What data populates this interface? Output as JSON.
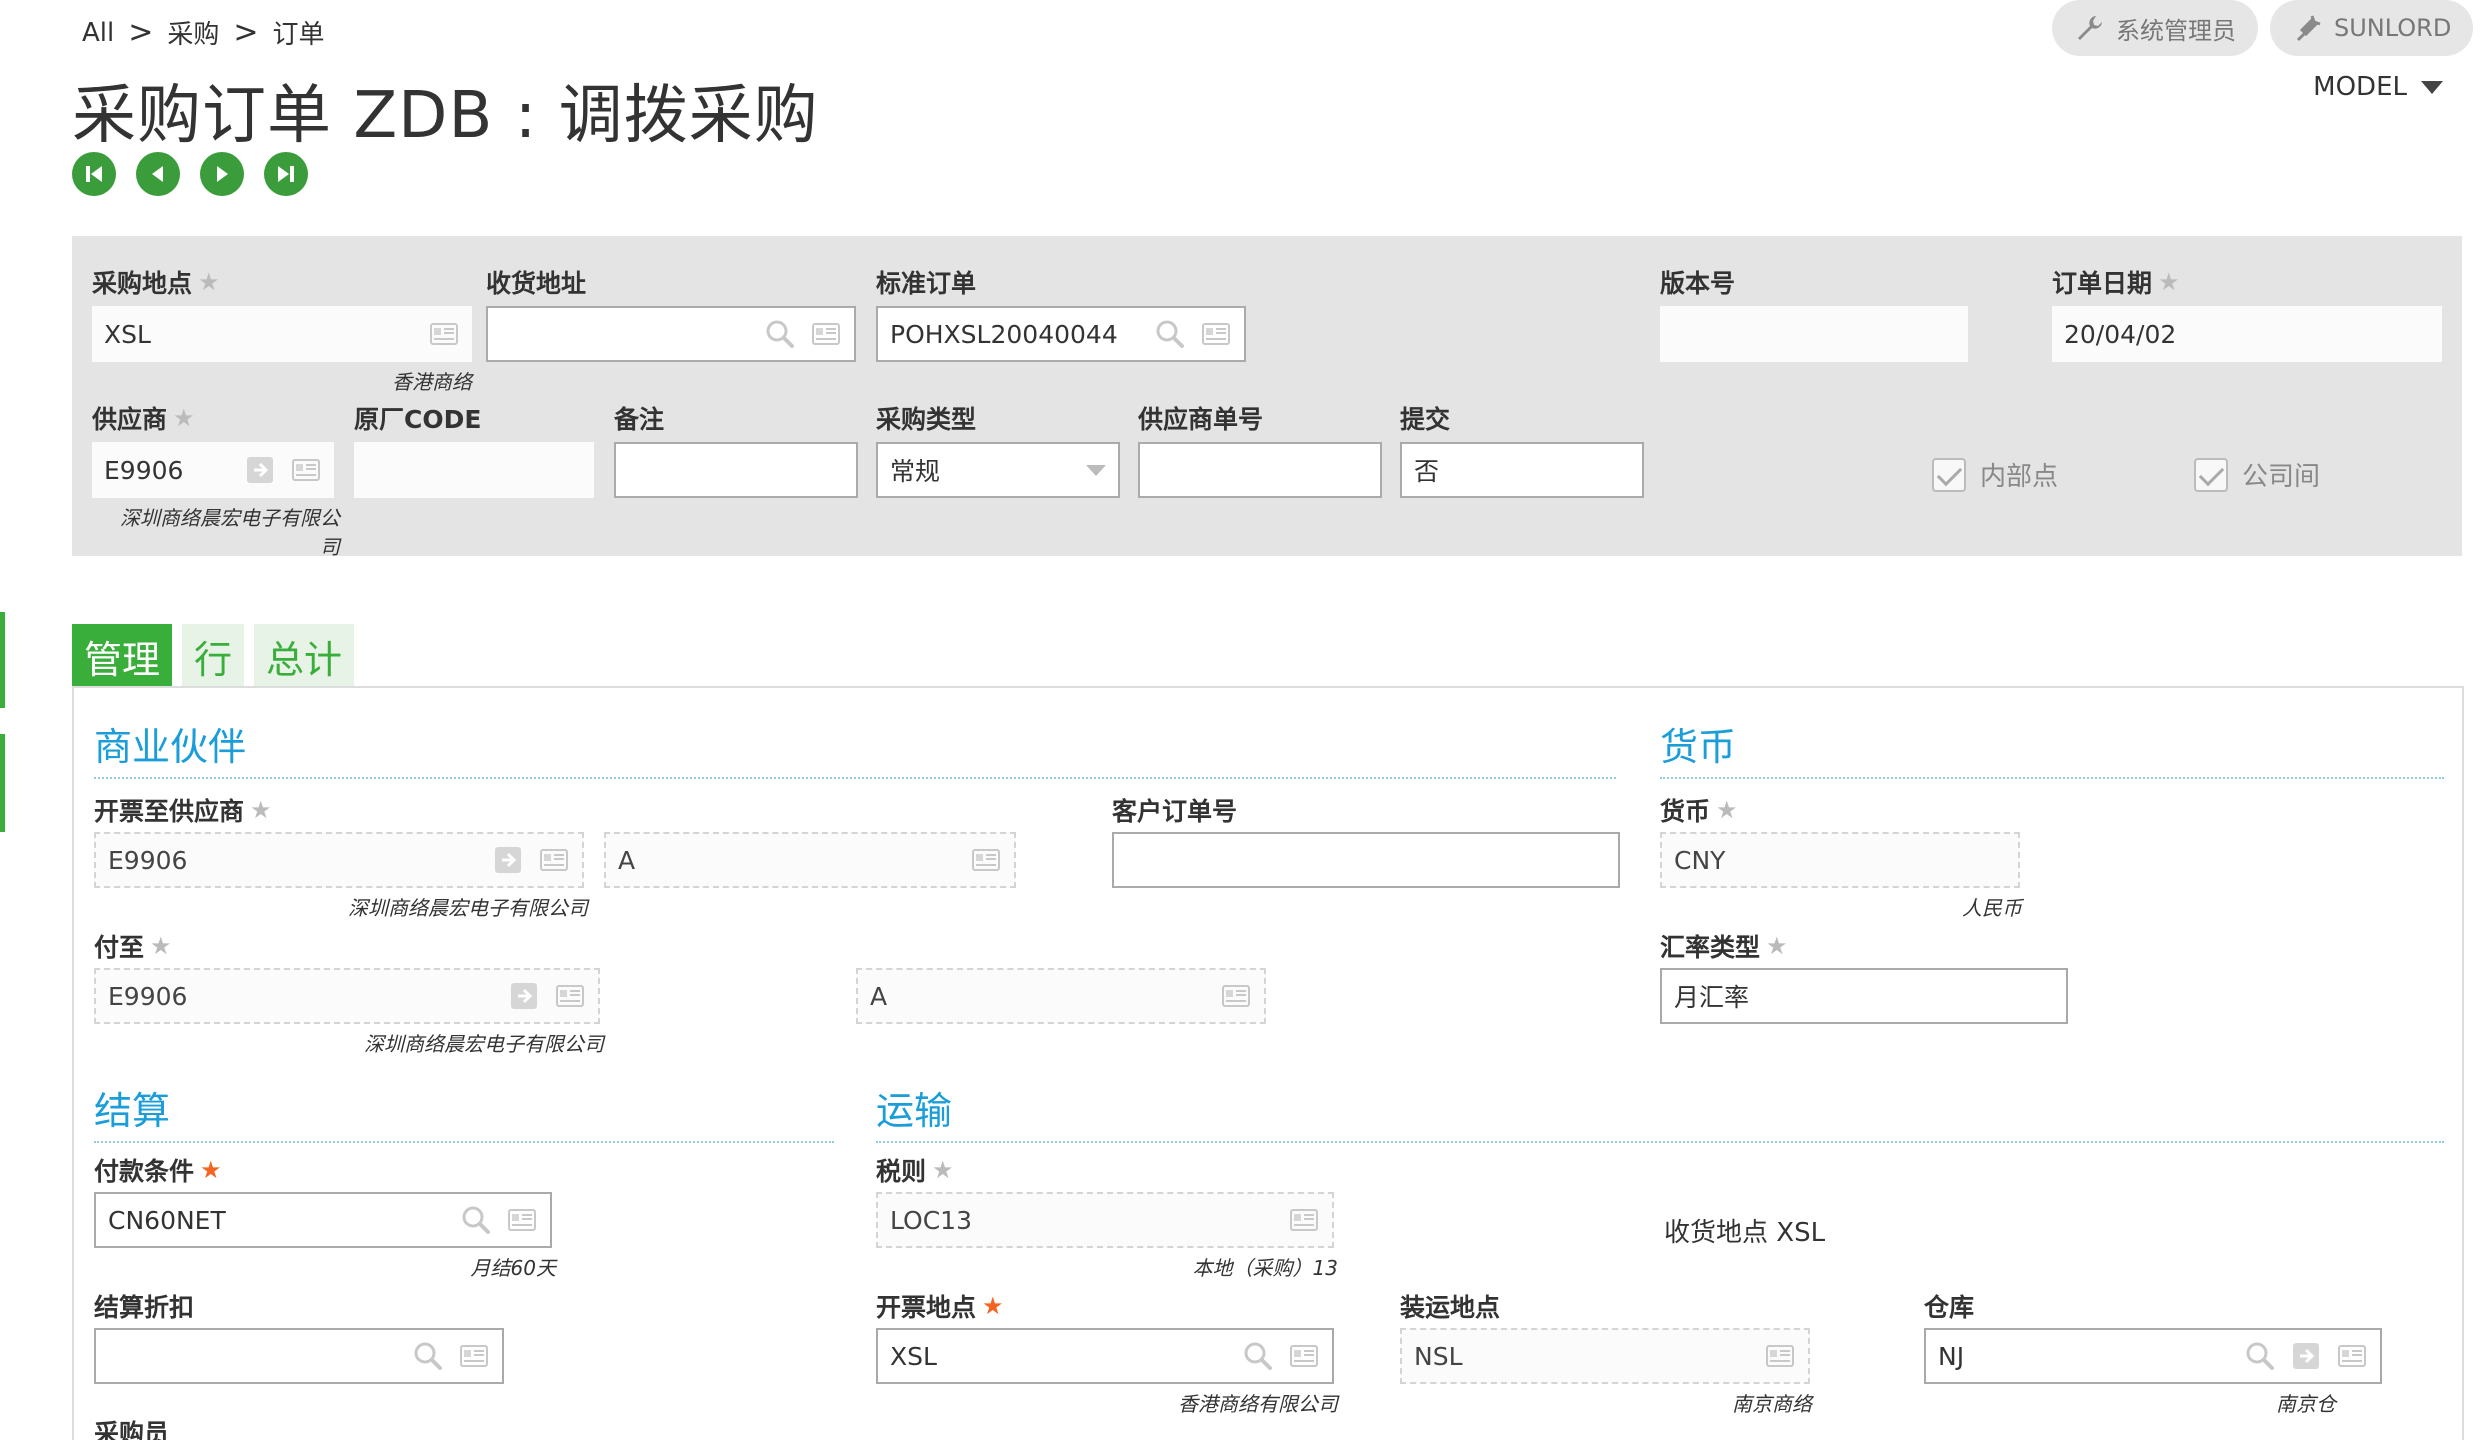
{
  "breadcrumb": {
    "item1": "All",
    "item2": "采购",
    "item3": "订单",
    "sep": ">"
  },
  "header": {
    "user_label": "系统管理员",
    "company_label": "SUNLORD",
    "model_label": "MODEL",
    "title": "采购订单 ZDB : 调拨采购"
  },
  "top_panel": {
    "purchase_site": {
      "label": "采购地点",
      "value": "XSL",
      "sub": "香港商络"
    },
    "delivery_address": {
      "label": "收货地址",
      "value": ""
    },
    "standard_order": {
      "label": "标准订单",
      "value": "POHXSL20040044"
    },
    "version": {
      "label": "版本号",
      "value": ""
    },
    "order_date": {
      "label": "订单日期",
      "value": "20/04/02"
    },
    "supplier": {
      "label": "供应商",
      "value": "E9906",
      "sub_line1": "深圳商络晨宏电子有限公",
      "sub_line2": "司"
    },
    "factory_code": {
      "label": "原厂CODE",
      "value": ""
    },
    "remark": {
      "label": "备注",
      "value": ""
    },
    "purchase_type": {
      "label": "采购类型",
      "value": "常规"
    },
    "supplier_order_no": {
      "label": "供应商单号",
      "value": ""
    },
    "submit": {
      "label": "提交",
      "value": "否"
    },
    "internal_site": {
      "label": "内部点",
      "checked": true
    },
    "intercompany": {
      "label": "公司间",
      "checked": true
    }
  },
  "tabs": [
    {
      "label": "管理",
      "active": true
    },
    {
      "label": "行",
      "active": false
    },
    {
      "label": "总计",
      "active": false
    }
  ],
  "business_partner": {
    "title": "商业伙伴",
    "invoice_supplier": {
      "label": "开票至供应商",
      "value": "E9906",
      "sub": "深圳商络晨宏电子有限公司",
      "address": "A"
    },
    "customer_order_no": {
      "label": "客户订单号",
      "value": ""
    },
    "pay_to": {
      "label": "付至",
      "value": "E9906",
      "sub": "深圳商络晨宏电子有限公司",
      "address": "A"
    }
  },
  "currency": {
    "title": "货币",
    "currency": {
      "label": "货币",
      "value": "CNY",
      "sub": "人民币"
    },
    "rate_type": {
      "label": "汇率类型",
      "value": "月汇率"
    }
  },
  "settlement": {
    "title": "结算",
    "payment_terms": {
      "label": "付款条件",
      "value": "CN60NET",
      "sub": "月结60天"
    },
    "discount": {
      "label": "结算折扣",
      "value": ""
    },
    "buyer": {
      "label": "采购员"
    }
  },
  "transport": {
    "title": "运输",
    "tax_rule": {
      "label": "税则",
      "value": "LOC13",
      "sub": "本地（采购）13"
    },
    "receive_site_text": "收货地点 XSL",
    "invoice_site": {
      "label": "开票地点",
      "value": "XSL",
      "sub": "香港商络有限公司"
    },
    "ship_site": {
      "label": "装运地点",
      "value": "NSL",
      "sub": "南京商络"
    },
    "warehouse": {
      "label": "仓库",
      "value": "NJ",
      "sub": "南京仓"
    }
  },
  "colors": {
    "accent_green": "#3aae3a",
    "section_blue": "#1a9dd9",
    "required": "#f26522"
  }
}
